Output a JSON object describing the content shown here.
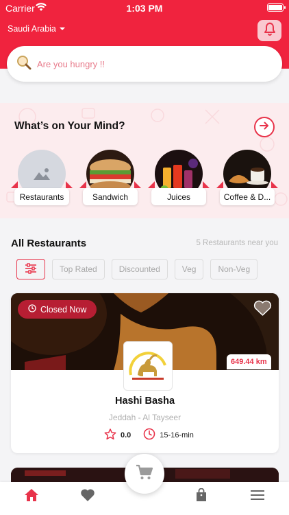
{
  "status_bar": {
    "carrier": "Carrier",
    "time": "1:03 PM"
  },
  "header": {
    "country": "Saudi Arabia"
  },
  "search": {
    "placeholder": "Are you hungry !!"
  },
  "mind": {
    "title": "What’s on Your Mind?",
    "categories": [
      {
        "label": "Restaurants",
        "image": "placeholder-image-icon"
      },
      {
        "label": "Sandwich",
        "image": "sandwich-photo"
      },
      {
        "label": "Juices",
        "image": "juices-photo"
      },
      {
        "label": "Coffee & D...",
        "image": "coffee-photo"
      }
    ]
  },
  "restaurants": {
    "title": "All Restaurants",
    "near_text": "5 Restaurants near you",
    "filters": [
      "Top Rated",
      "Discounted",
      "Veg",
      "Non-Veg"
    ],
    "items": [
      {
        "status": "Closed Now",
        "distance": "649.44 km",
        "name": "Hashi Basha",
        "location": "Jeddah - Al Tayseer",
        "rating": "0.0",
        "time": "15-16-min"
      }
    ]
  },
  "colors": {
    "brand": "#f0233e",
    "accent": "#e8334a",
    "closed_badge": "#b71e33"
  },
  "tabbar": {
    "items": [
      "home-icon",
      "heart-icon",
      "cart-icon",
      "bag-icon",
      "menu-icon"
    ],
    "active": "home-icon"
  }
}
